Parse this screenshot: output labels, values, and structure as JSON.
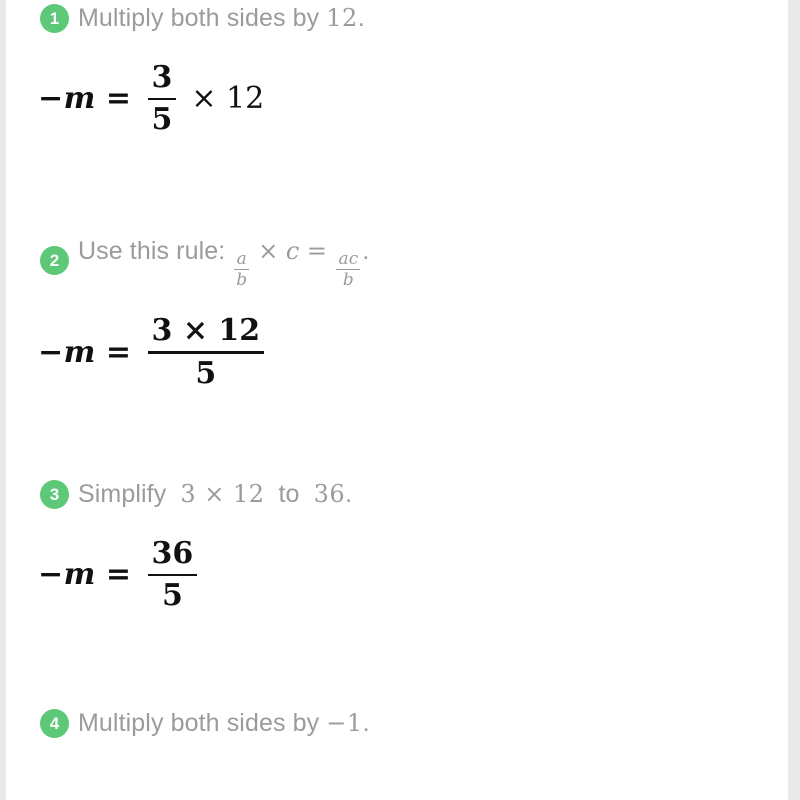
{
  "theme": {
    "page_background": "#e9e9ec",
    "card_background": "#ffffff",
    "badge_color": "#5cc878",
    "badge_text_color": "#ffffff",
    "label_text_color": "#9b9b9b",
    "equation_text_color": "#111111"
  },
  "steps": [
    {
      "number": "1",
      "label_prefix": "Multiply both sides by",
      "label_math": "12",
      "label_suffix": ".",
      "equation": {
        "lhs": "−m",
        "equals": "=",
        "numerator": "3",
        "denominator": "5",
        "tail": "× 12"
      }
    },
    {
      "number": "2",
      "label_prefix": "Use this rule:",
      "rule": {
        "frac1_num": "a",
        "frac1_den": "b",
        "operator": "×",
        "factor": "c",
        "equals": "=",
        "frac2_num": "ac",
        "frac2_den": "b"
      },
      "label_suffix": ".",
      "equation": {
        "lhs": "−m",
        "equals": "=",
        "numerator": "3 × 12",
        "denominator": "5",
        "tail": ""
      }
    },
    {
      "number": "3",
      "label_prefix": "Simplify",
      "label_math": "3 × 12",
      "label_middle": "to",
      "label_math2": "36",
      "label_suffix": ".",
      "equation": {
        "lhs": "−m",
        "equals": "=",
        "numerator": "36",
        "denominator": "5",
        "tail": ""
      }
    },
    {
      "number": "4",
      "label_prefix": "Multiply both sides by",
      "label_math": "−1",
      "label_suffix": "."
    }
  ]
}
